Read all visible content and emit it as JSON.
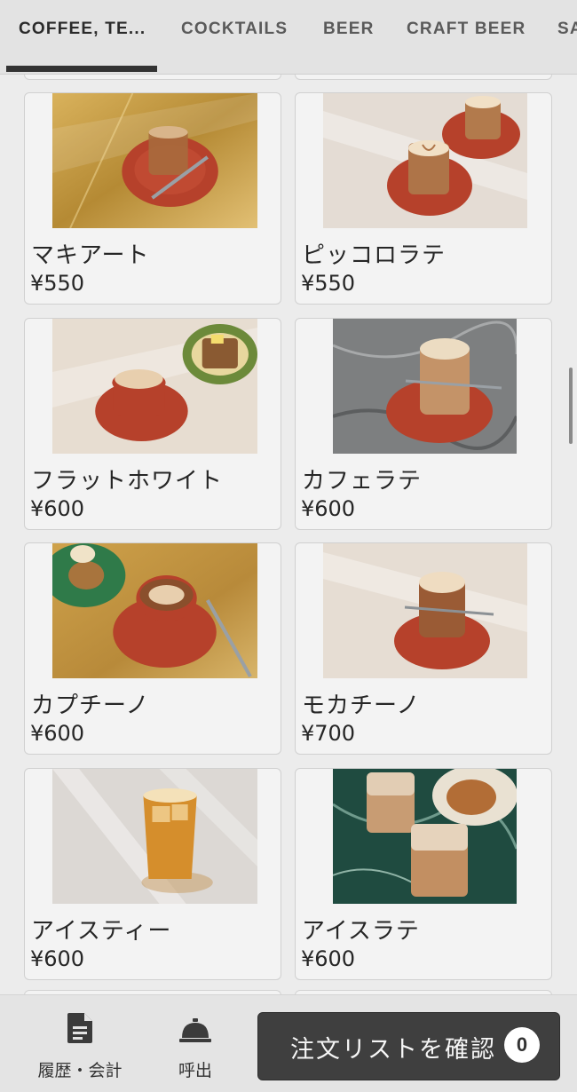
{
  "tabs": [
    {
      "label": "COFFEE, TE...",
      "active": true
    },
    {
      "label": "COCKTAILS",
      "active": false
    },
    {
      "label": "BEER",
      "active": false
    },
    {
      "label": "CRAFT BEER",
      "active": false
    },
    {
      "label": "SA",
      "active": false
    }
  ],
  "menu_items": [
    {
      "name": "マキアート",
      "price": "¥550"
    },
    {
      "name": "ピッコロラテ",
      "price": "¥550"
    },
    {
      "name": "フラットホワイト",
      "price": "¥600"
    },
    {
      "name": "カフェラテ",
      "price": "¥600"
    },
    {
      "name": "カプチーノ",
      "price": "¥600"
    },
    {
      "name": "モカチーノ",
      "price": "¥700"
    },
    {
      "name": "アイスティー",
      "price": "¥600"
    },
    {
      "name": "アイスラテ",
      "price": "¥600"
    }
  ],
  "bottom_nav": {
    "history_label": "履歴・会計",
    "call_label": "呼出",
    "order_label": "注文リストを確認",
    "order_count": "0"
  },
  "icons": {
    "history": "document-icon",
    "call": "service-bell-icon"
  },
  "colors": {
    "tab_indicator": "#333333",
    "order_button": "#3f3f3f",
    "saucer": "#c0402a",
    "page_background": "#ececec"
  }
}
